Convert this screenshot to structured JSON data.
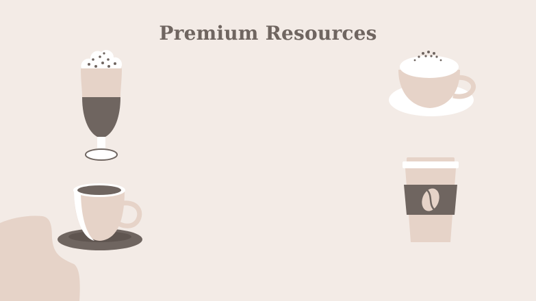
{
  "slide": {
    "title": "Premium Resources"
  },
  "icons": [
    "whipped-cream-glass-icon",
    "cappuccino-cup-icon",
    "espresso-cup-icon",
    "takeaway-coffee-cup-icon",
    "coffee-bean-icon"
  ],
  "colors": {
    "background": "#f3ebe6",
    "title": "#6f6560",
    "dark_brown": "#6f6560",
    "light_beige": "#e6d3c8",
    "white": "#ffffff"
  }
}
